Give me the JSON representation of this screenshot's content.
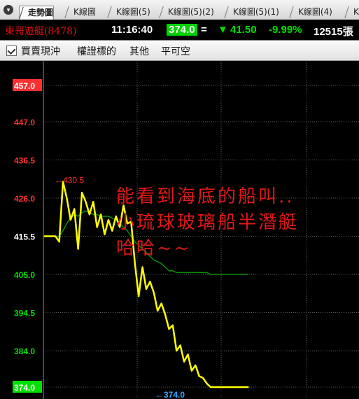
{
  "tabs": [
    "走勢圖",
    "K線圖",
    "K線圖(5)",
    "K線圖(5)(2)",
    "K線圖(5)(1)",
    "K線圖(4)",
    "K"
  ],
  "quote": {
    "stock": "東哥遊艇(8478)",
    "time": "11:16:40",
    "price": "374.0",
    "flag": "=",
    "change": "41.50",
    "percent": "-9.99%",
    "volume": "12515張"
  },
  "functions": [
    "買賣現沖",
    "權證標的",
    "其他",
    "平可空"
  ],
  "colors": {
    "price_line": "#ffff00",
    "avg_line": "#0a8f0a",
    "up": "#ff3030",
    "down": "#00e000",
    "grid": "#5a5a5a",
    "annotation": "#e01818"
  },
  "chart_data": {
    "type": "line",
    "y_ticks": [
      "457.0",
      "447.0",
      "436.5",
      "426.0",
      "415.5",
      "405.0",
      "394.5",
      "384.0",
      "374.0"
    ],
    "ylim": [
      374.0,
      457.0
    ],
    "reference_price": "415.5",
    "high_label": "←430.5",
    "low_label": "←374.0",
    "high": 430.5,
    "low": 374.0,
    "series": [
      {
        "values": [
          415.5,
          415.5,
          415.5,
          415.5,
          414.0,
          430.5,
          426.0,
          420.0,
          423.0,
          412.0,
          427.5,
          425.0,
          421.5,
          425.0,
          418.0,
          421.5,
          416.0,
          420.0,
          417.0,
          421.0,
          418.0,
          424.0,
          419.0,
          419.5,
          408.0,
          399.0,
          407.0,
          401.0,
          403.0,
          400.0,
          395.0,
          397.0,
          394.0,
          390.0,
          391.0,
          384.0,
          385.5,
          381.0,
          383.0,
          378.5,
          380.0,
          377.0,
          376.5,
          375.0,
          374.0,
          374.0,
          374.0,
          374.0,
          374.0,
          374.0,
          374.0,
          374.0,
          374.0,
          374.0,
          374.0
        ]
      },
      {
        "values": [
          415.5,
          415.5,
          415.5,
          415.5,
          415.5,
          417.0,
          419.0,
          420.5,
          421.5,
          421.0,
          422.0,
          422.5,
          422.0,
          421.5,
          421.5,
          421.0,
          421.0,
          421.0,
          420.5,
          420.0,
          419.0,
          418.0,
          417.0,
          415.5,
          414.0,
          413.0,
          412.0,
          411.0,
          410.0,
          409.0,
          408.5,
          408.0,
          407.0,
          406.0,
          406.0,
          405.5,
          405.5,
          405.5,
          405.5,
          405.5,
          405.5,
          405.5,
          405.5,
          405.5,
          405.0,
          405.0,
          405.0,
          405.0,
          405.0,
          405.0,
          405.0,
          405.0,
          405.0,
          405.0,
          405.0
        ]
      }
    ]
  },
  "annotation": [
    "能看到海底的船叫..",
    "小琉球玻璃船半潛艇",
    "哈哈~~"
  ]
}
